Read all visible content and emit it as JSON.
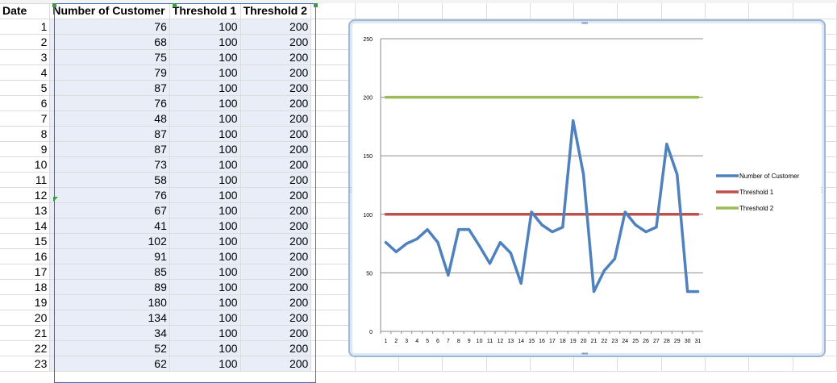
{
  "sheet": {
    "headers": [
      "Date",
      "Number of Customer",
      "Threshold 1",
      "Threshold 2"
    ],
    "rows": [
      [
        "1",
        "76",
        "100",
        "200"
      ],
      [
        "2",
        "68",
        "100",
        "200"
      ],
      [
        "3",
        "75",
        "100",
        "200"
      ],
      [
        "4",
        "79",
        "100",
        "200"
      ],
      [
        "5",
        "87",
        "100",
        "200"
      ],
      [
        "6",
        "76",
        "100",
        "200"
      ],
      [
        "7",
        "48",
        "100",
        "200"
      ],
      [
        "8",
        "87",
        "100",
        "200"
      ],
      [
        "9",
        "87",
        "100",
        "200"
      ],
      [
        "10",
        "73",
        "100",
        "200"
      ],
      [
        "11",
        "58",
        "100",
        "200"
      ],
      [
        "12",
        "76",
        "100",
        "200"
      ],
      [
        "13",
        "67",
        "100",
        "200"
      ],
      [
        "14",
        "41",
        "100",
        "200"
      ],
      [
        "15",
        "102",
        "100",
        "200"
      ],
      [
        "16",
        "91",
        "100",
        "200"
      ],
      [
        "17",
        "85",
        "100",
        "200"
      ],
      [
        "18",
        "89",
        "100",
        "200"
      ],
      [
        "19",
        "180",
        "100",
        "200"
      ],
      [
        "20",
        "134",
        "100",
        "200"
      ],
      [
        "21",
        "34",
        "100",
        "200"
      ],
      [
        "22",
        "52",
        "100",
        "200"
      ],
      [
        "23",
        "62",
        "100",
        "200"
      ]
    ]
  },
  "chart_data": {
    "type": "line",
    "x": [
      1,
      2,
      3,
      4,
      5,
      6,
      7,
      8,
      9,
      10,
      11,
      12,
      13,
      14,
      15,
      16,
      17,
      18,
      19,
      20,
      21,
      22,
      23,
      24,
      25,
      26,
      27,
      28,
      29,
      30,
      31
    ],
    "series": [
      {
        "name": "Number of Customer",
        "color": "#4f81bd",
        "values": [
          76,
          68,
          75,
          79,
          87,
          76,
          48,
          87,
          87,
          73,
          58,
          76,
          67,
          41,
          102,
          91,
          85,
          89,
          180,
          134,
          34,
          52,
          62,
          102,
          91,
          85,
          89,
          160,
          134,
          34,
          34
        ]
      },
      {
        "name": "Threshold 1",
        "color": "#c0504d",
        "values": [
          100,
          100,
          100,
          100,
          100,
          100,
          100,
          100,
          100,
          100,
          100,
          100,
          100,
          100,
          100,
          100,
          100,
          100,
          100,
          100,
          100,
          100,
          100,
          100,
          100,
          100,
          100,
          100,
          100,
          100,
          100
        ]
      },
      {
        "name": "Threshold 2",
        "color": "#9bbb59",
        "values": [
          200,
          200,
          200,
          200,
          200,
          200,
          200,
          200,
          200,
          200,
          200,
          200,
          200,
          200,
          200,
          200,
          200,
          200,
          200,
          200,
          200,
          200,
          200,
          200,
          200,
          200,
          200,
          200,
          200,
          200,
          200
        ]
      }
    ],
    "ylim": [
      0,
      250
    ],
    "yticks": [
      "0",
      "50",
      "100",
      "150",
      "200",
      "250"
    ],
    "grid": true,
    "legend": "right",
    "title": "",
    "xlabel": "",
    "ylabel": ""
  }
}
